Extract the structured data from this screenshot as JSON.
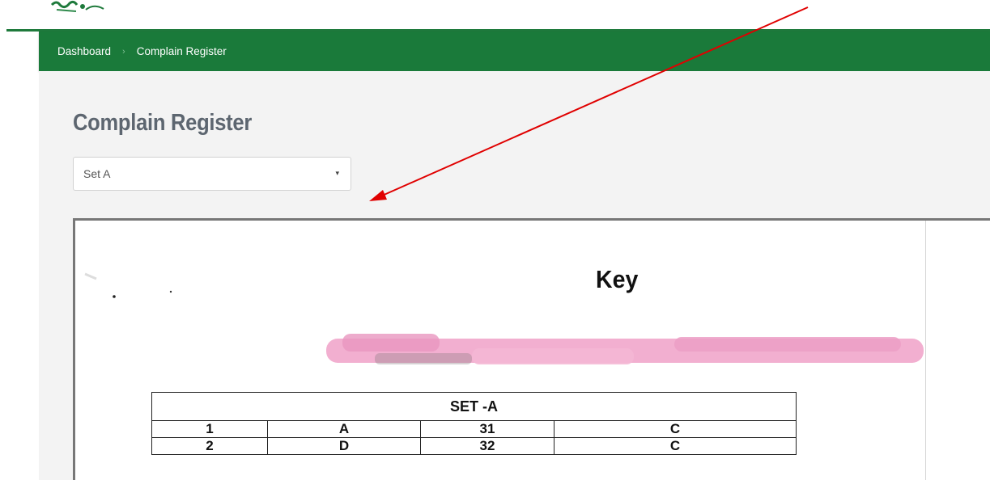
{
  "breadcrumb": {
    "items": [
      "Dashboard",
      "Complain Register"
    ],
    "separator": "›"
  },
  "page": {
    "title": "Complain Register"
  },
  "set_select": {
    "value": "Set A",
    "caret": "▾"
  },
  "document": {
    "heading": "Key",
    "table": {
      "header": "SET -A",
      "rows": [
        [
          "1",
          "A",
          "31",
          "C"
        ],
        [
          "2",
          "D",
          "32",
          "C"
        ]
      ]
    }
  },
  "colors": {
    "brand_green": "#1a7a3a",
    "annotation_arrow": "#e00000",
    "redaction": "#f1a6cb"
  }
}
